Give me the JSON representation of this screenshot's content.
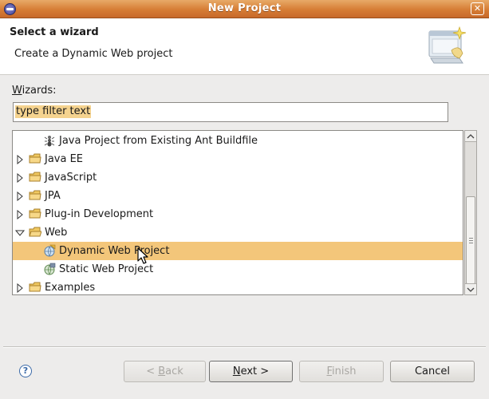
{
  "window": {
    "title": "New Project",
    "close_symbol": "✕"
  },
  "header": {
    "title": "Select a wizard",
    "description": "Create a Dynamic Web project"
  },
  "wizards_label": {
    "prefix": "W",
    "rest": "izards:"
  },
  "filter": {
    "placeholder": "type filter text",
    "value": ""
  },
  "tree": {
    "items": [
      {
        "label": "Java Project from Existing Ant Buildfile",
        "type": "item",
        "level": 1,
        "expanded": false,
        "selected": false
      },
      {
        "label": "Java EE",
        "type": "folder",
        "level": 0,
        "expanded": false,
        "selected": false
      },
      {
        "label": "JavaScript",
        "type": "folder",
        "level": 0,
        "expanded": false,
        "selected": false
      },
      {
        "label": "JPA",
        "type": "folder",
        "level": 0,
        "expanded": false,
        "selected": false
      },
      {
        "label": "Plug-in Development",
        "type": "folder",
        "level": 0,
        "expanded": false,
        "selected": false
      },
      {
        "label": "Web",
        "type": "folder",
        "level": 0,
        "expanded": true,
        "selected": false
      },
      {
        "label": "Dynamic Web Project",
        "type": "item",
        "level": 1,
        "expanded": false,
        "selected": true
      },
      {
        "label": "Static Web Project",
        "type": "item",
        "level": 1,
        "expanded": false,
        "selected": false
      },
      {
        "label": "Examples",
        "type": "folder",
        "level": 0,
        "expanded": false,
        "selected": false
      }
    ]
  },
  "buttons": {
    "help_symbol": "?",
    "back": {
      "mnemonic": "B",
      "prefix": "< ",
      "rest": "ack",
      "enabled": false
    },
    "next": {
      "mnemonic": "N",
      "prefix": "",
      "rest": "ext >",
      "enabled": true
    },
    "finish": {
      "mnemonic": "F",
      "prefix": "",
      "rest": "inish",
      "enabled": false
    },
    "cancel": {
      "label": "Cancel",
      "enabled": true
    }
  },
  "colors": {
    "titlebar": "#d67d35",
    "selection": "#f3c67a",
    "filter_highlight": "#f5d38f"
  }
}
